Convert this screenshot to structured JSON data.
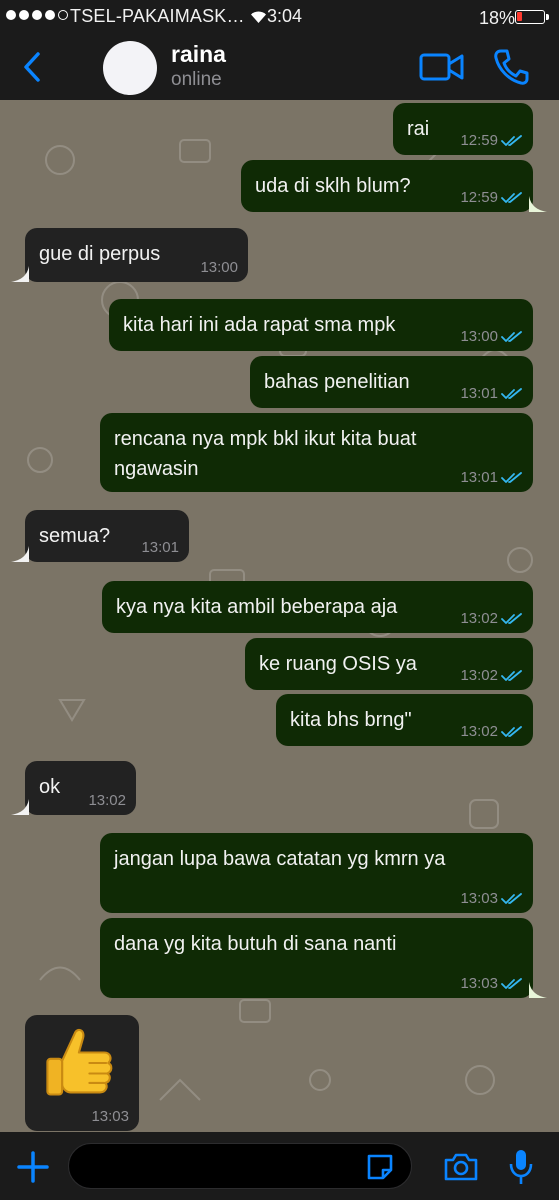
{
  "status_bar": {
    "carrier": "TSEL-PAKAIMASK…",
    "time": "3:04",
    "battery_percent": "18%",
    "battery_level": 0.18,
    "signal_bars": 4,
    "icons": [
      "signal-dots-icon",
      "wifi-icon",
      "battery-icon"
    ]
  },
  "header": {
    "back_icon": "chevron-left-icon",
    "contact_name": "raina",
    "presence": "online",
    "video_icon": "video-camera-icon",
    "phone_icon": "phone-icon",
    "accent_color": "#0a84ff"
  },
  "messages": [
    {
      "direction": "out",
      "text": "rai",
      "time": "12:59",
      "read": true
    },
    {
      "direction": "out",
      "text": "uda di sklh blum?",
      "time": "12:59",
      "read": true
    },
    {
      "direction": "in",
      "text": "gue di perpus",
      "time": "13:00"
    },
    {
      "direction": "out",
      "text": "kita hari ini ada rapat sma mpk",
      "time": "13:00",
      "read": true
    },
    {
      "direction": "out",
      "text": "bahas penelitian",
      "time": "13:01",
      "read": true
    },
    {
      "direction": "out",
      "text": "rencana nya mpk bkl ikut kita buat",
      "text_line2": "ngawasin",
      "time": "13:01",
      "read": true
    },
    {
      "direction": "in",
      "text": "semua?",
      "time": "13:01"
    },
    {
      "direction": "out",
      "text": "kya nya kita ambil beberapa aja",
      "time": "13:02",
      "read": true
    },
    {
      "direction": "out",
      "text": "ke ruang OSIS ya",
      "time": "13:02",
      "read": true
    },
    {
      "direction": "out",
      "text": "kita bhs brng\"",
      "time": "13:02",
      "read": true
    },
    {
      "direction": "in",
      "text": "ok",
      "time": "13:02"
    },
    {
      "direction": "out",
      "text": "jangan lupa bawa catatan yg kmrn ya",
      "time": "13:03",
      "read": true
    },
    {
      "direction": "out",
      "text": "dana yg kita butuh di sana nanti",
      "time": "13:03",
      "read": true
    },
    {
      "direction": "in",
      "type": "emoji",
      "emoji": "thumbs-up-icon",
      "time": "13:03"
    }
  ],
  "colors": {
    "outgoing_bubble": "#0f2a05",
    "incoming_bubble": "#222222",
    "chat_background": "#7b7466",
    "read_ticks": "#34b7f1"
  },
  "input_bar": {
    "placeholder": "",
    "icons": [
      "plus-icon",
      "sticker-icon",
      "camera-icon",
      "microphone-icon"
    ]
  }
}
